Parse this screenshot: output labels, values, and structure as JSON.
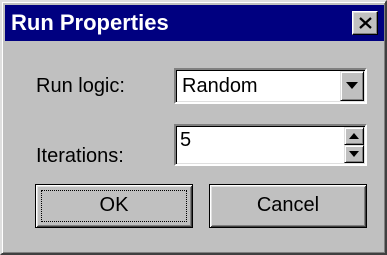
{
  "dialog": {
    "title": "Run Properties"
  },
  "icons": {
    "close": "close-icon",
    "dropdown": "triangle-down-icon",
    "spin_up": "triangle-up-icon",
    "spin_down": "triangle-down-icon"
  },
  "run_logic": {
    "label": "Run logic:",
    "selected": "Random"
  },
  "iterations": {
    "label": "Iterations:",
    "value": "5"
  },
  "buttons": {
    "ok": "OK",
    "cancel": "Cancel"
  },
  "colors": {
    "title_bar": "#000080",
    "face": "#c0c0c0",
    "title_text": "#ffffff"
  }
}
